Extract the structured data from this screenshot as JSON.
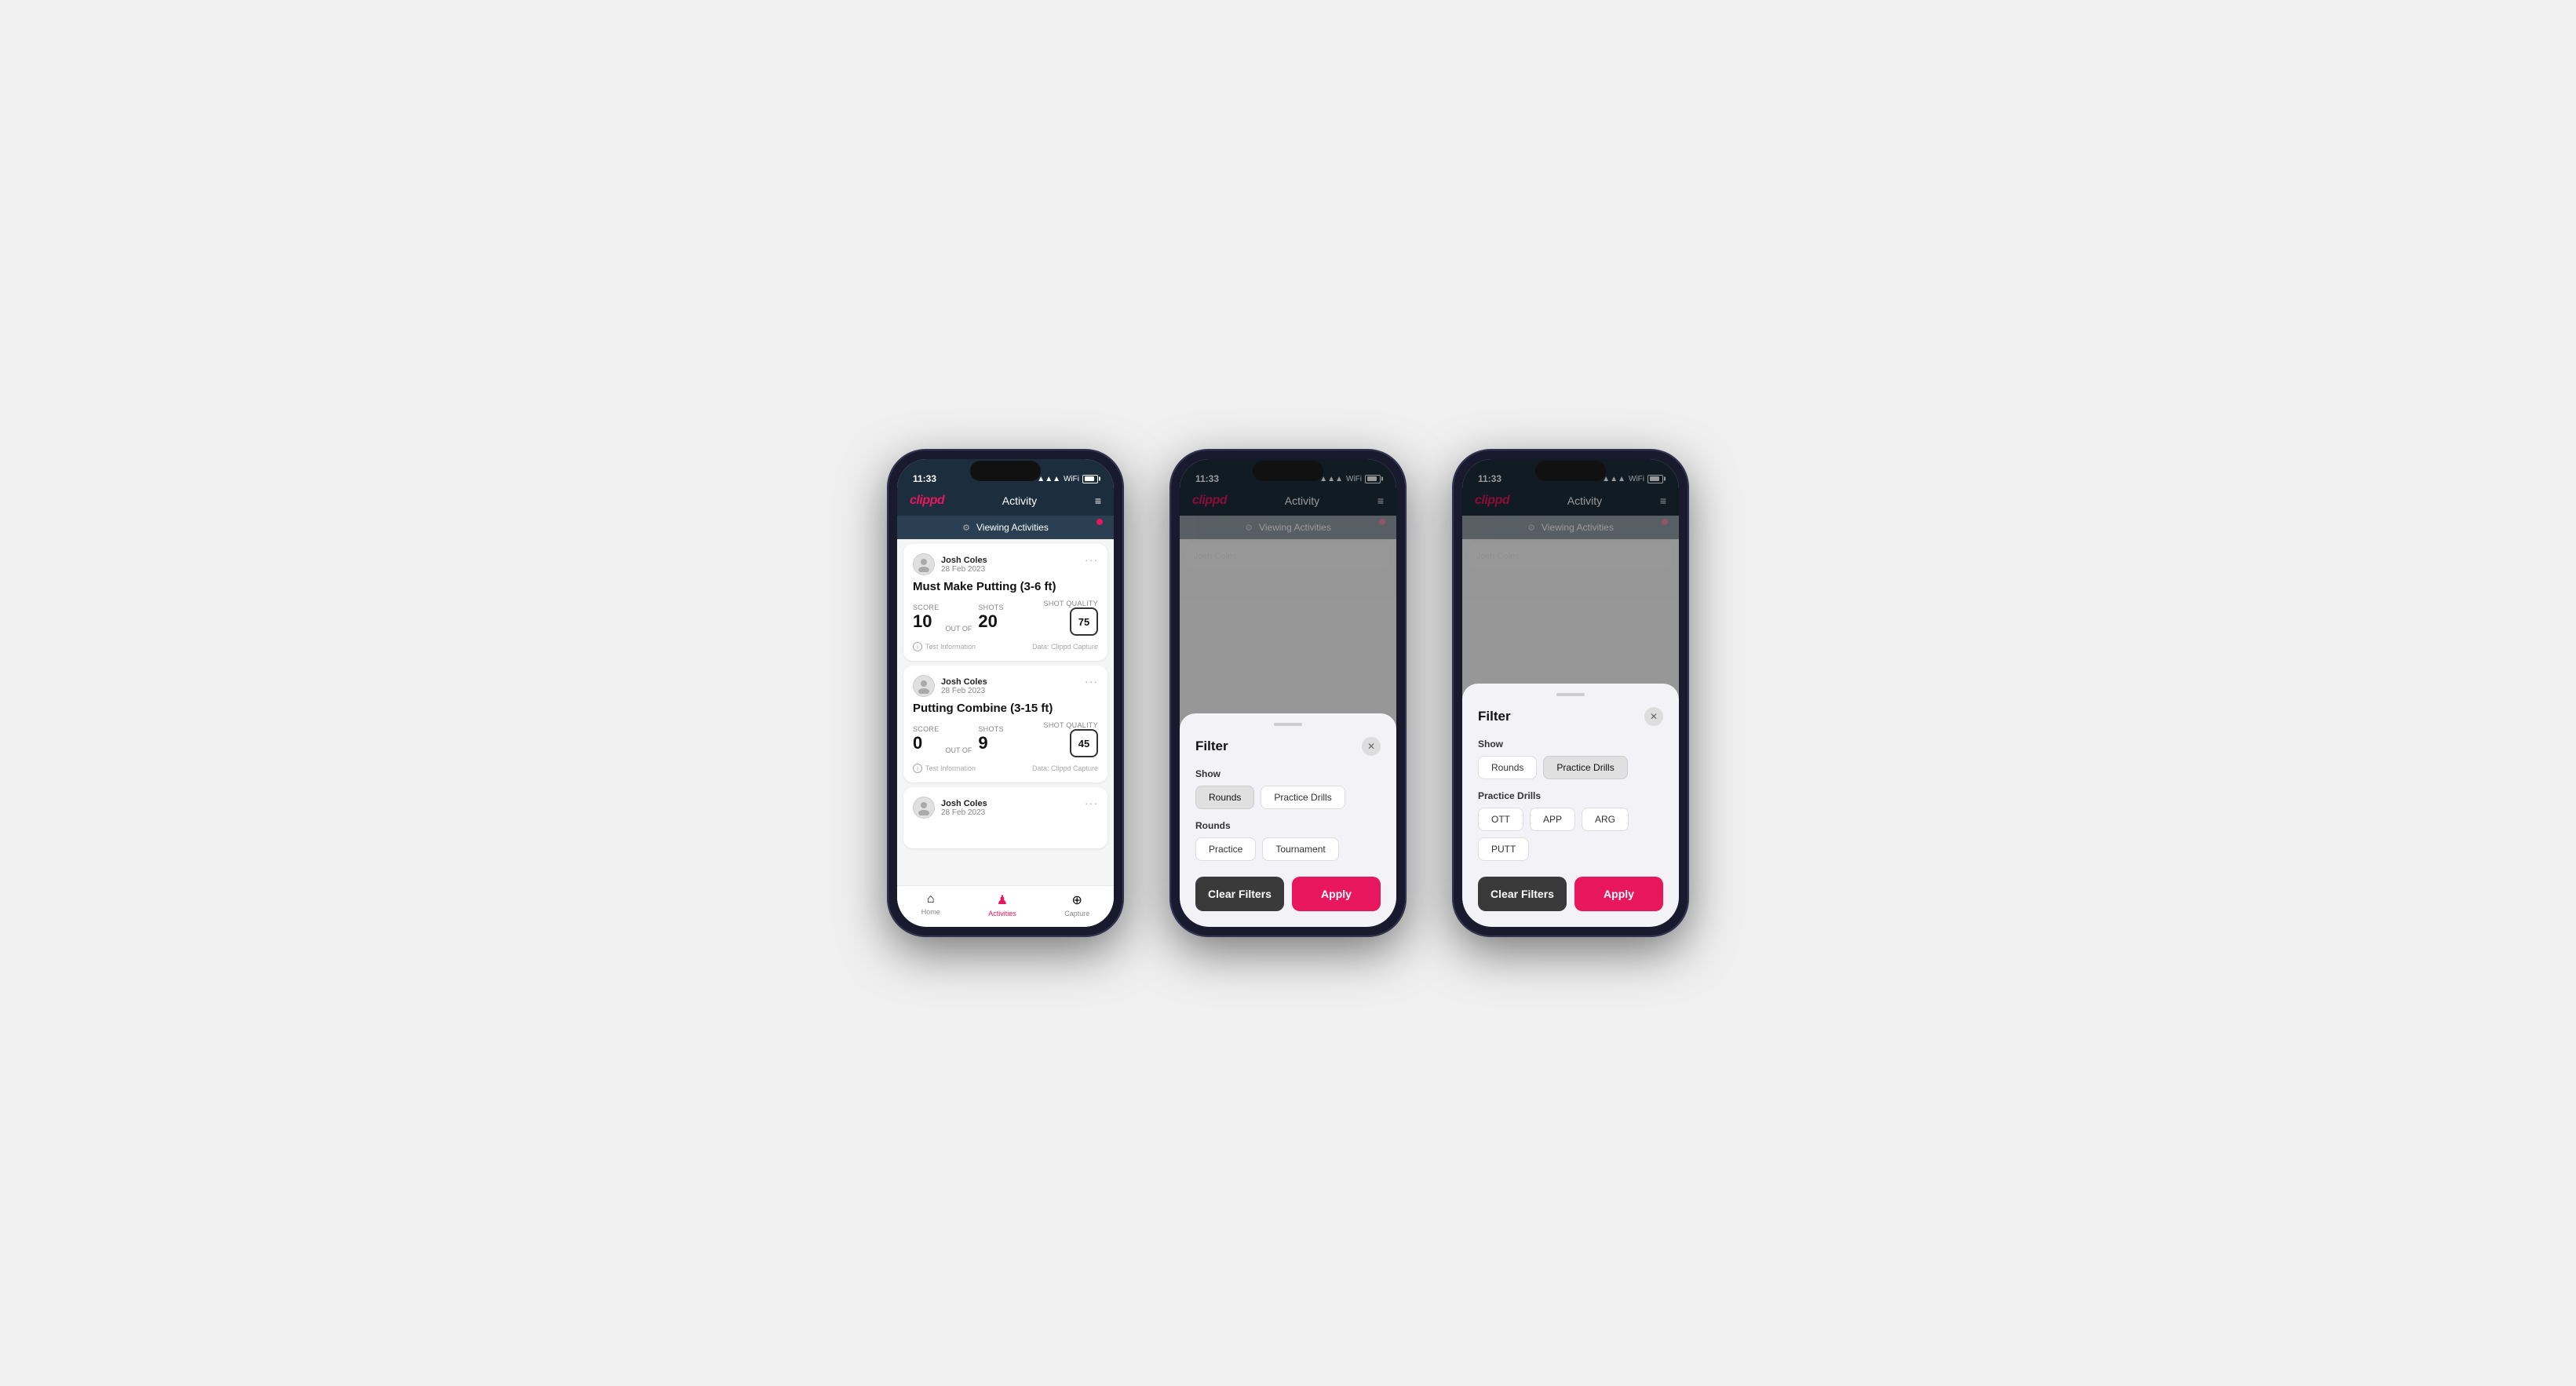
{
  "statusBar": {
    "time": "11:33",
    "batteryPercent": "81"
  },
  "nav": {
    "logo": "clippd",
    "title": "Activity",
    "menuIcon": "≡"
  },
  "viewingBanner": {
    "text": "Viewing Activities",
    "filterIcon": "⚙"
  },
  "phone1": {
    "cards": [
      {
        "user": "Josh Coles",
        "date": "28 Feb 2023",
        "title": "Must Make Putting (3-6 ft)",
        "scoreLbl": "Score",
        "score": "10",
        "outOf": "OUT OF",
        "shotsLbl": "Shots",
        "shots": "20",
        "shotQualityLbl": "Shot Quality",
        "shotQuality": "75",
        "footerLeft": "Test Information",
        "footerRight": "Data: Clippd Capture"
      },
      {
        "user": "Josh Coles",
        "date": "28 Feb 2023",
        "title": "Putting Combine (3-15 ft)",
        "scoreLbl": "Score",
        "score": "0",
        "outOf": "OUT OF",
        "shotsLbl": "Shots",
        "shots": "9",
        "shotQualityLbl": "Shot Quality",
        "shotQuality": "45",
        "footerLeft": "Test Information",
        "footerRight": "Data: Clippd Capture"
      },
      {
        "user": "Josh Coles",
        "date": "28 Feb 2023",
        "title": "",
        "score": "",
        "shots": "",
        "shotQuality": ""
      }
    ],
    "tabs": [
      {
        "label": "Home",
        "icon": "⌂",
        "active": false
      },
      {
        "label": "Activities",
        "icon": "♟",
        "active": true
      },
      {
        "label": "Capture",
        "icon": "⊕",
        "active": false
      }
    ]
  },
  "phone2": {
    "filter": {
      "title": "Filter",
      "showLabel": "Show",
      "showOptions": [
        {
          "label": "Rounds",
          "selected": true
        },
        {
          "label": "Practice Drills",
          "selected": false
        }
      ],
      "roundsLabel": "Rounds",
      "roundsOptions": [
        {
          "label": "Practice",
          "selected": false
        },
        {
          "label": "Tournament",
          "selected": false
        }
      ],
      "clearLabel": "Clear Filters",
      "applyLabel": "Apply"
    }
  },
  "phone3": {
    "filter": {
      "title": "Filter",
      "showLabel": "Show",
      "showOptions": [
        {
          "label": "Rounds",
          "selected": false
        },
        {
          "label": "Practice Drills",
          "selected": true
        }
      ],
      "practiceLabel": "Practice Drills",
      "practiceOptions": [
        {
          "label": "OTT",
          "selected": false
        },
        {
          "label": "APP",
          "selected": false
        },
        {
          "label": "ARG",
          "selected": false
        },
        {
          "label": "PUTT",
          "selected": false
        }
      ],
      "clearLabel": "Clear Filters",
      "applyLabel": "Apply"
    }
  }
}
